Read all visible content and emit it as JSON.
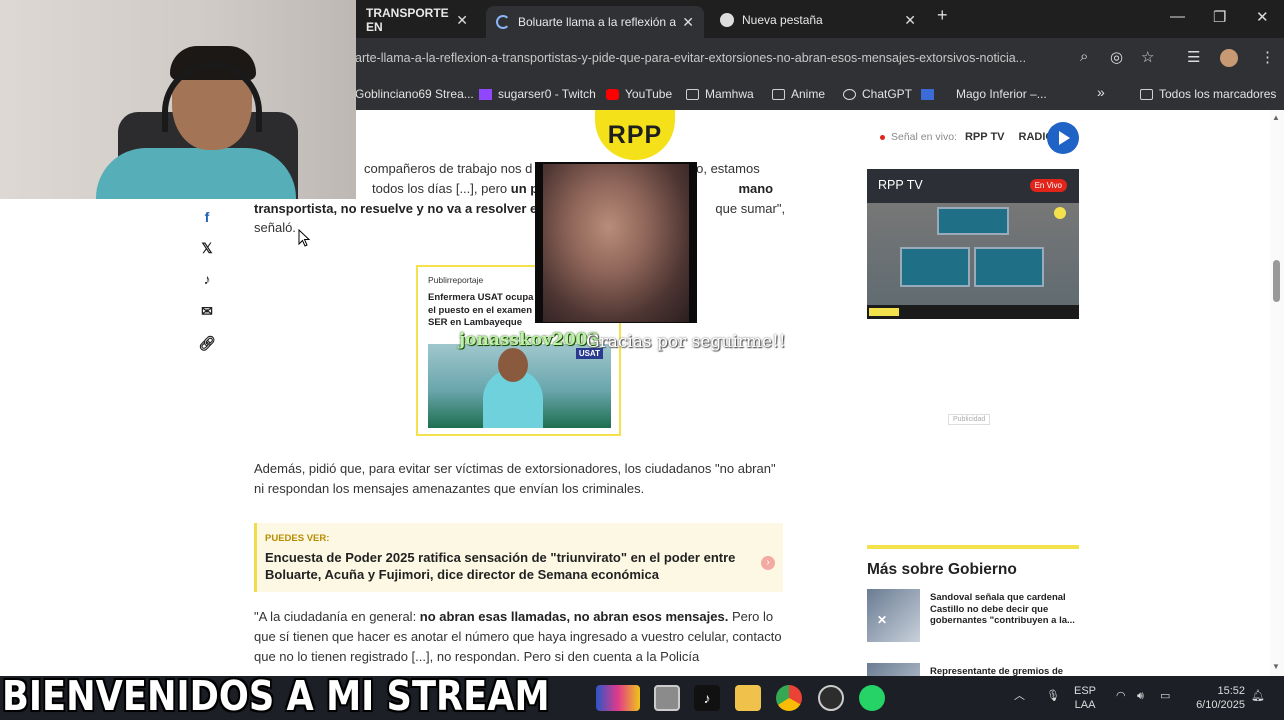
{
  "browser": {
    "tabs": [
      {
        "label": "TRANSPORTE EN",
        "active": false
      },
      {
        "label": "Boluarte llama a la reflexión a t",
        "active": true
      },
      {
        "label": "Nueva pestaña",
        "active": false
      }
    ],
    "url": "arte-llama-a-la-reflexion-a-transportistas-y-pide-que-para-evitar-extorsiones-no-abran-esos-mensajes-extorsivos-noticia...",
    "bookmarks": [
      {
        "label": "Goblinciano69 Strea...",
        "icon": "twitch-icon"
      },
      {
        "label": "sugarser0 - Twitch",
        "icon": "twitch-icon"
      },
      {
        "label": "YouTube",
        "icon": "youtube-icon"
      },
      {
        "label": "Mamhwa",
        "icon": "folder-icon"
      },
      {
        "label": "Anime",
        "icon": "folder-icon"
      },
      {
        "label": "ChatGPT",
        "icon": "chatgpt-icon"
      },
      {
        "label": "Mago Inferior –...",
        "icon": "bookmark-icon"
      }
    ],
    "all_bookmarks": "Todos los marcadores"
  },
  "header": {
    "logo": "RPP",
    "live_label": "Señal en vivo:",
    "live_tv": "RPP TV",
    "live_radio": "RADIO"
  },
  "article": {
    "p1_a": "compañeros de trabajo nos d",
    "p1_b": "eso, estamos",
    "p1_c": "todos los días [...], pero",
    "p1_d": "un paro",
    "p1_e": "mano",
    "p1_f": "transportista, no resuelve y no va a resolver el p",
    "p1_g": "que sumar\",",
    "p1_h": "señaló.",
    "p2": "Además, pidió que, para evitar ser víctimas de extorsionadores, los ciudadanos \"no abran\" ni respondan los mensajes amenazantes que envían los criminales.",
    "p3_a": "\"A la ciudadanía en general: ",
    "p3_b": "no abran esas llamadas, no abran esos mensajes.",
    "p3_c": " Pero lo que sí tienen que hacer es anotar el número que haya ingresado a vuestro celular, contacto que no lo tienen registrado [...], no respondan. Pero si den cuenta a la Policía"
  },
  "promo": {
    "tag": "Publirreportaje",
    "title": "Enfermera USAT ocupa el puesto en el examen SER en Lambayeque",
    "logo": "USAT"
  },
  "puedes_ver": {
    "tag": "PUEDES VER:",
    "title": "Encuesta de Poder 2025 ratifica sensación de \"triunvirato\" en el poder entre Boluarte, Acuña y Fujimori, dice director de Semana económica"
  },
  "sidebar": {
    "rpptv_title": "RPP TV",
    "rpptv_live": "En Vivo",
    "ad_label": "Publicidad",
    "mas_title": "Más sobre Gobierno",
    "mas_items": [
      "Sandoval señala que cardenal Castillo no debe decir que gobernantes \"contribuyen a la...",
      "Representante de gremios de"
    ]
  },
  "stream": {
    "follower": "jonasskov2003",
    "follow_message": "Gracias por seguirme!!",
    "banner": "BIENVENIDOS A MI STREAM"
  },
  "taskbar": {
    "lang_top": "ESP",
    "lang_bottom": "LAA",
    "time": "15:52",
    "date": "6/10/2025"
  }
}
